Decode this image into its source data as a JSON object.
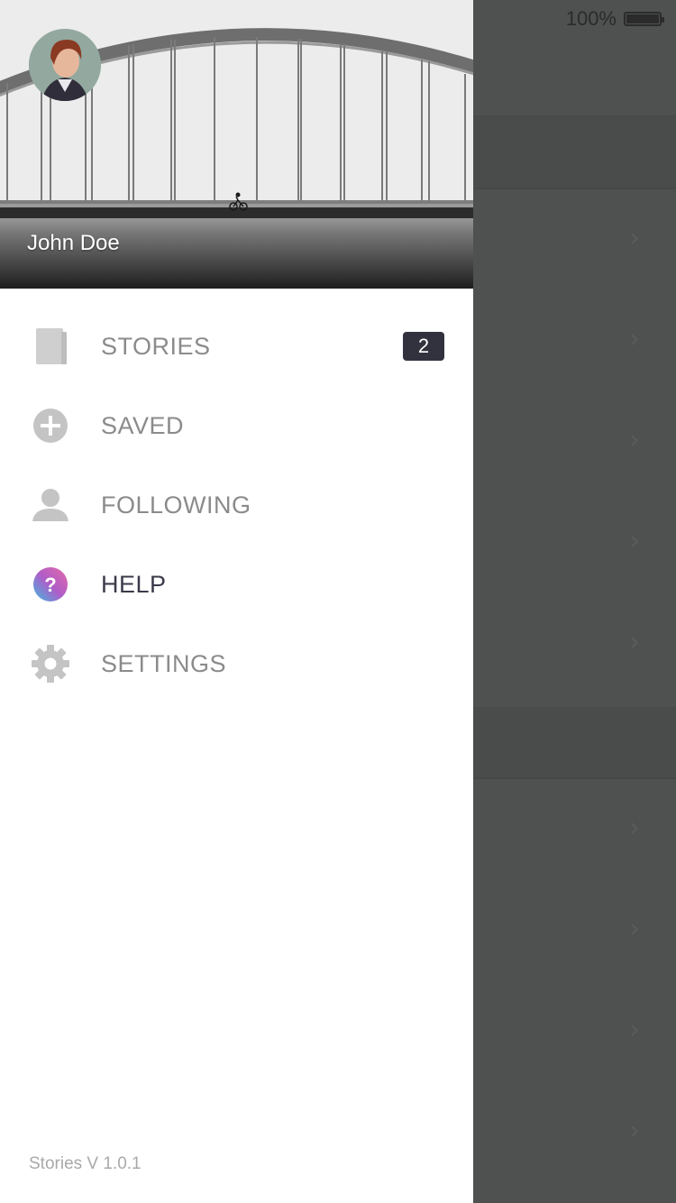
{
  "status_bar": {
    "battery_percent_label": "100%",
    "battery_level": 1.0
  },
  "drawer": {
    "profile": {
      "name": "John Doe",
      "avatar_icon": "avatar-photo"
    },
    "menu": [
      {
        "id": "stories",
        "label": "STORIES",
        "icon": "book-icon",
        "badge": "2",
        "active": false
      },
      {
        "id": "saved",
        "label": "SAVED",
        "icon": "plus-circle-icon",
        "active": false
      },
      {
        "id": "following",
        "label": "FOLLOWING",
        "icon": "person-icon",
        "active": false
      },
      {
        "id": "help",
        "label": "HELP",
        "icon": "question-icon",
        "active": true
      },
      {
        "id": "settings",
        "label": "SETTINGS",
        "icon": "gear-icon",
        "active": false
      }
    ],
    "version": "Stories V 1.0.1"
  },
  "colors": {
    "overlay": "#4f5050",
    "menu_text": "#8b8b8b",
    "menu_text_active": "#3a3a4a",
    "badge_bg": "#32323f",
    "help_gradient": [
      "#3fb9e0",
      "#b05cc8",
      "#e46ca8"
    ]
  }
}
